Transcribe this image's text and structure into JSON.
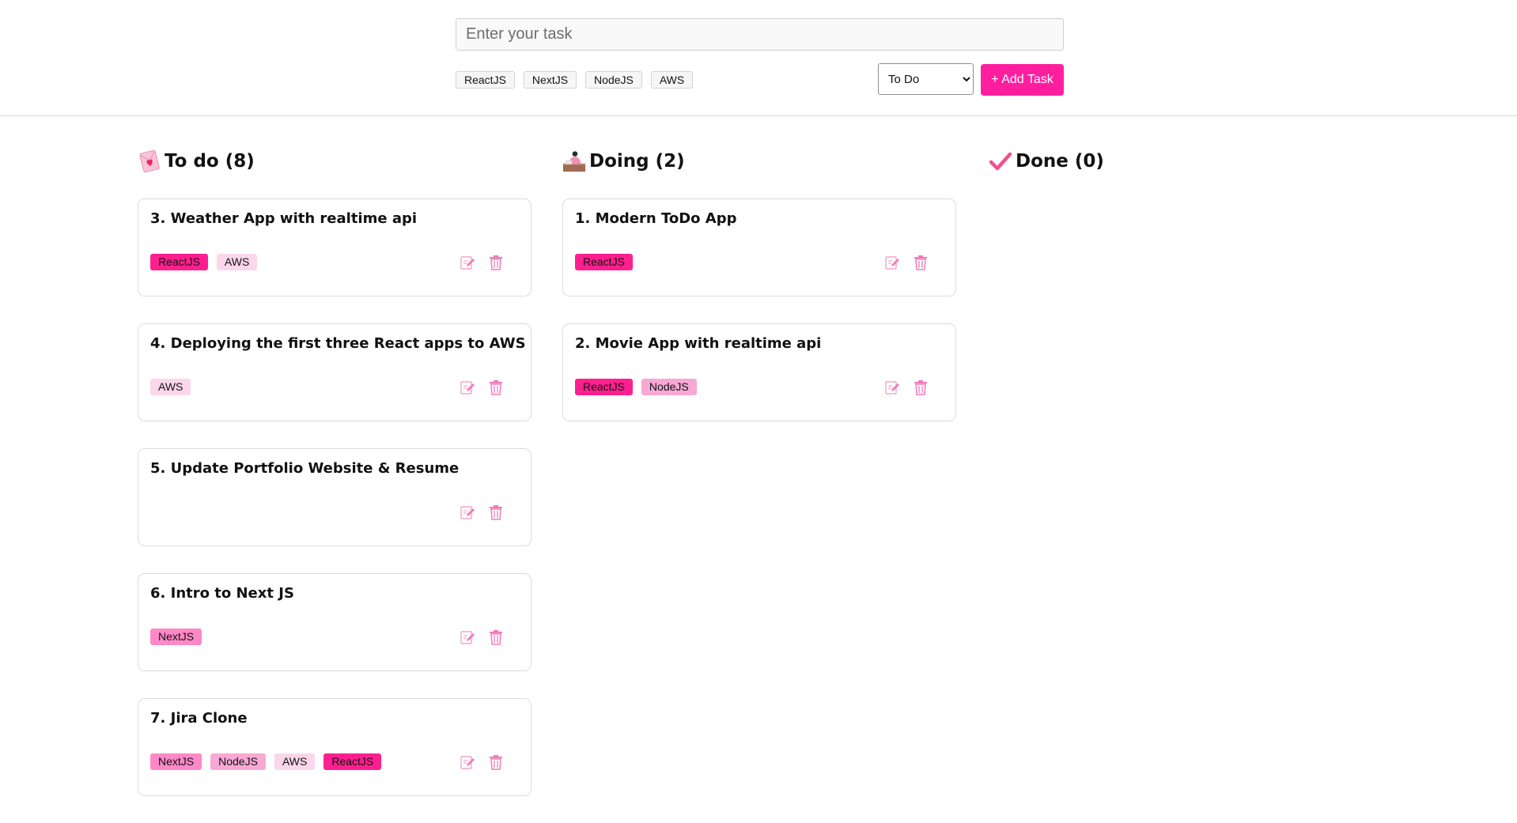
{
  "header": {
    "task_input_placeholder": "Enter your task",
    "task_input_value": "",
    "tag_options": [
      "ReactJS",
      "NextJS",
      "NodeJS",
      "AWS"
    ],
    "status_select": {
      "selected": "To Do",
      "options": [
        "To Do"
      ]
    },
    "add_button_label": "+ Add Task"
  },
  "colors": {
    "accent": "#ff1f9e",
    "tag_reactjs": "#ff1f8f",
    "tag_nextjs": "#ff88c8",
    "tag_nodejs": "#f8a8d4",
    "tag_aws": "#fcd6ea",
    "action_icon": "#f27bb8"
  },
  "columns": [
    {
      "key": "todo",
      "title": "To do (8)",
      "icon": "love-letter-icon",
      "tasks": [
        {
          "title": "3. Weather App with realtime api",
          "tags": [
            "ReactJS",
            "AWS"
          ]
        },
        {
          "title": "4. Deploying the first three React apps to AWS",
          "tags": [
            "AWS"
          ]
        },
        {
          "title": "5. Update Portfolio Website & Resume",
          "tags": []
        },
        {
          "title": "6. Intro to Next JS",
          "tags": [
            "NextJS"
          ]
        },
        {
          "title": "7. Jira Clone",
          "tags": [
            "NextJS",
            "NodeJS",
            "AWS",
            "ReactJS"
          ]
        }
      ]
    },
    {
      "key": "doing",
      "title": "Doing (2)",
      "icon": "person-at-desk-icon",
      "tasks": [
        {
          "title": "1. Modern ToDo App",
          "tags": [
            "ReactJS"
          ]
        },
        {
          "title": "2. Movie App with realtime api",
          "tags": [
            "ReactJS",
            "NodeJS"
          ]
        }
      ]
    },
    {
      "key": "done",
      "title": "Done (0)",
      "icon": "check-mark-icon",
      "tasks": []
    }
  ],
  "card_actions": {
    "edit_icon": "edit-icon",
    "delete_icon": "trash-icon"
  }
}
